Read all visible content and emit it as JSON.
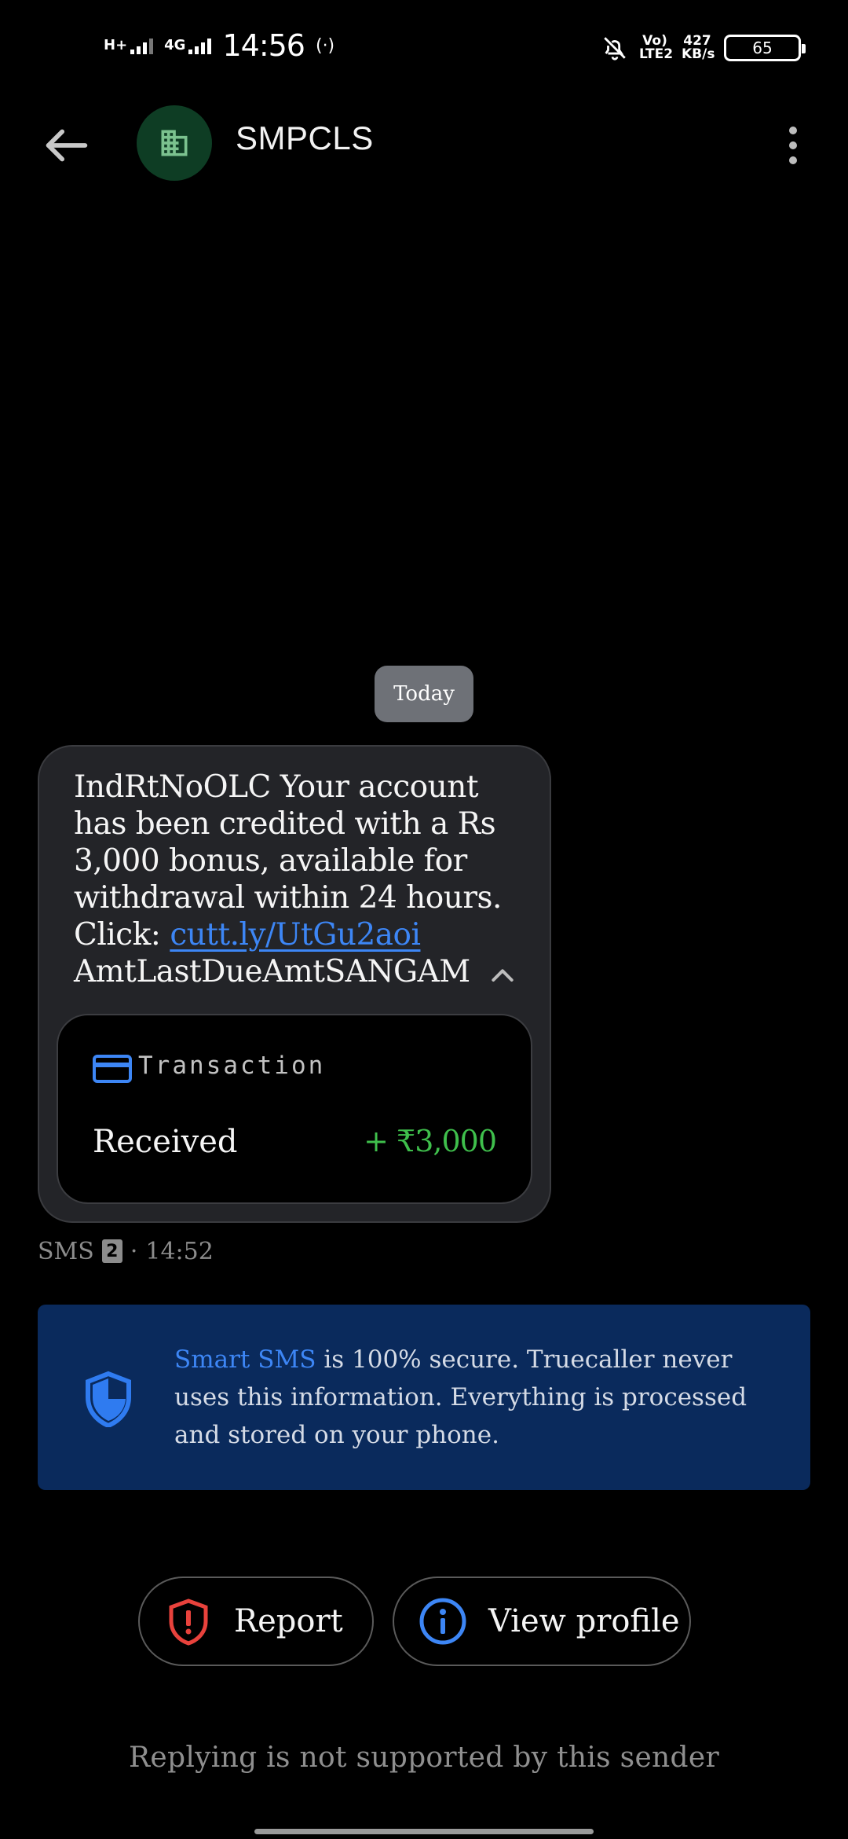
{
  "status_bar": {
    "net1": "H+",
    "net2": "4G",
    "time": "14:56",
    "hotspot": "(·)",
    "volte": "Vo) LTE2",
    "speed": "427 KB/s",
    "battery": "65"
  },
  "header": {
    "title": "SMPCLS",
    "avatar_icon": "building-icon",
    "accent": "#0e3d24"
  },
  "divider": {
    "date": "Today"
  },
  "message": {
    "text_before": "IndRtNoOLC Your account has been credited with a Rs 3,000 bonus, available for withdrawal within 24 hours. Click: ",
    "link": "cutt.ly/UtGu2aoi",
    "text_after": " AmtLastDueAmtSANGAM",
    "transaction": {
      "label": "Transaction",
      "type": "Received",
      "amount": "+ ₹3,000",
      "amount_color": "#3fbf4c"
    },
    "meta": {
      "channel": "SMS",
      "sim": "2",
      "separator": "·",
      "time": "14:52"
    }
  },
  "banner": {
    "highlight": "Smart SMS",
    "text": " is 100% secure. Truecaller never uses this information. Everything is processed and stored on your phone.",
    "bg_color": "#0a2a5c"
  },
  "actions": {
    "report_label": "Report",
    "profile_label": "View profile"
  },
  "footer": {
    "note": "Replying is not supported by this sender"
  }
}
